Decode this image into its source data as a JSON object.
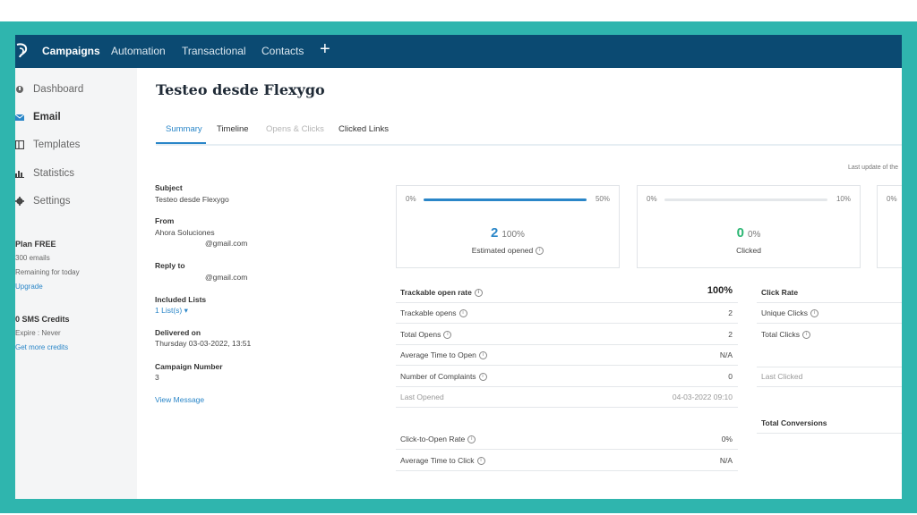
{
  "nav": {
    "items": [
      {
        "label": "Campaigns",
        "active": true
      },
      {
        "label": "Automation",
        "active": false
      },
      {
        "label": "Transactional",
        "active": false
      },
      {
        "label": "Contacts",
        "active": false
      }
    ],
    "plus_label": "+"
  },
  "sidebar": {
    "items": [
      {
        "label": "Dashboard",
        "icon": "dashboard-icon"
      },
      {
        "label": "Email",
        "icon": "envelope-icon",
        "active": true
      },
      {
        "label": "Templates",
        "icon": "templates-icon"
      },
      {
        "label": "Statistics",
        "icon": "statistics-icon"
      },
      {
        "label": "Settings",
        "icon": "gear-icon"
      }
    ],
    "plan": {
      "title": "Plan FREE",
      "emails": "300 emails",
      "remaining": "Remaining for today",
      "upgrade": "Upgrade"
    },
    "sms": {
      "title": "0 SMS Credits",
      "expire": "Expire : Never",
      "more": "Get more credits"
    }
  },
  "main": {
    "title": "Testeo desde Flexygo",
    "tabs": [
      {
        "label": "Summary",
        "state": "active"
      },
      {
        "label": "Timeline",
        "state": "normal"
      },
      {
        "label": "Opens & Clicks",
        "state": "disabled"
      },
      {
        "label": "Clicked Links",
        "state": "normal"
      }
    ],
    "last_update": "Last update of the"
  },
  "meta": {
    "subject_label": "Subject",
    "subject_value": "Testeo desde Flexygo",
    "from_label": "From",
    "from_name": "Ahora Soluciones",
    "from_email": "@gmail.com",
    "reply_label": "Reply to",
    "reply_email": "@gmail.com",
    "included_label": "Included Lists",
    "included_value": "1 List(s) ▾",
    "delivered_label": "Delivered on",
    "delivered_value": "Thursday 03-03-2022, 13:51",
    "campaign_label": "Campaign Number",
    "campaign_value": "3",
    "view_message": "View Message"
  },
  "cards": [
    {
      "min": "0%",
      "max": "50%",
      "value": "2",
      "percent": "100%",
      "caption": "Estimated opened",
      "fill_fraction": 1.0,
      "color": "#2a86c8"
    },
    {
      "min": "0%",
      "max": "10%",
      "value": "0",
      "percent": "0%",
      "caption": "Clicked",
      "fill_fraction": 0.0,
      "color": "#2bb673"
    },
    {
      "min": "0%"
    }
  ],
  "opens_table": {
    "header": {
      "label": "Trackable open rate",
      "value": "100%"
    },
    "rows": [
      {
        "label": "Trackable opens",
        "value": "2"
      },
      {
        "label": "Total Opens",
        "value": "2"
      },
      {
        "label": "Average Time to Open",
        "value": "N/A"
      },
      {
        "label": "Number of Complaints",
        "value": "0"
      },
      {
        "label": "Last Opened",
        "value": "04-03-2022 09:10"
      }
    ],
    "rows2": [
      {
        "label": "Click-to-Open Rate",
        "value": "0%"
      },
      {
        "label": "Average Time to Click",
        "value": "N/A"
      }
    ]
  },
  "clicks_table": {
    "header": "Click Rate",
    "unique": "Unique Clicks",
    "total": "Total Clicks",
    "last": "Last Clicked",
    "conversions": "Total Conversions"
  },
  "colors": {
    "frame": "#2fb5ae",
    "topbar": "#0b4a72",
    "accent": "#2a86c8",
    "success": "#2bb673"
  }
}
